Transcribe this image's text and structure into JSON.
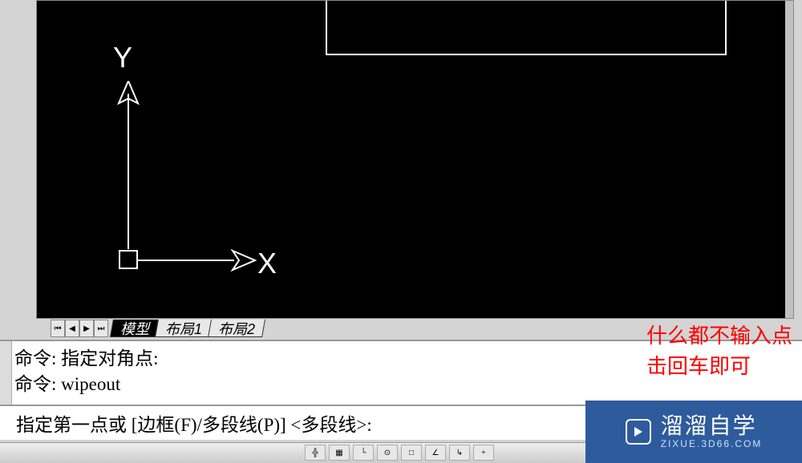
{
  "drawing": {
    "y_label": "Y",
    "x_label": "X"
  },
  "tabs": {
    "model": "模型",
    "layout1": "布局1",
    "layout2": "布局2"
  },
  "command": {
    "prefix": "命令:",
    "line1": "指定对角点:",
    "line2": "wipeout",
    "prompt": "指定第一点或 [边框(F)/多段线(P)] <多段线>:"
  },
  "annotation": {
    "line1": "什么都不输入点",
    "line2": "击回车即可"
  },
  "watermark": {
    "title": "溜溜自学",
    "url": "ZIXUE.3D66.COM"
  },
  "navglyphs": {
    "first": "⏮",
    "prev": "◀",
    "next": "▶",
    "last": "⏭"
  }
}
